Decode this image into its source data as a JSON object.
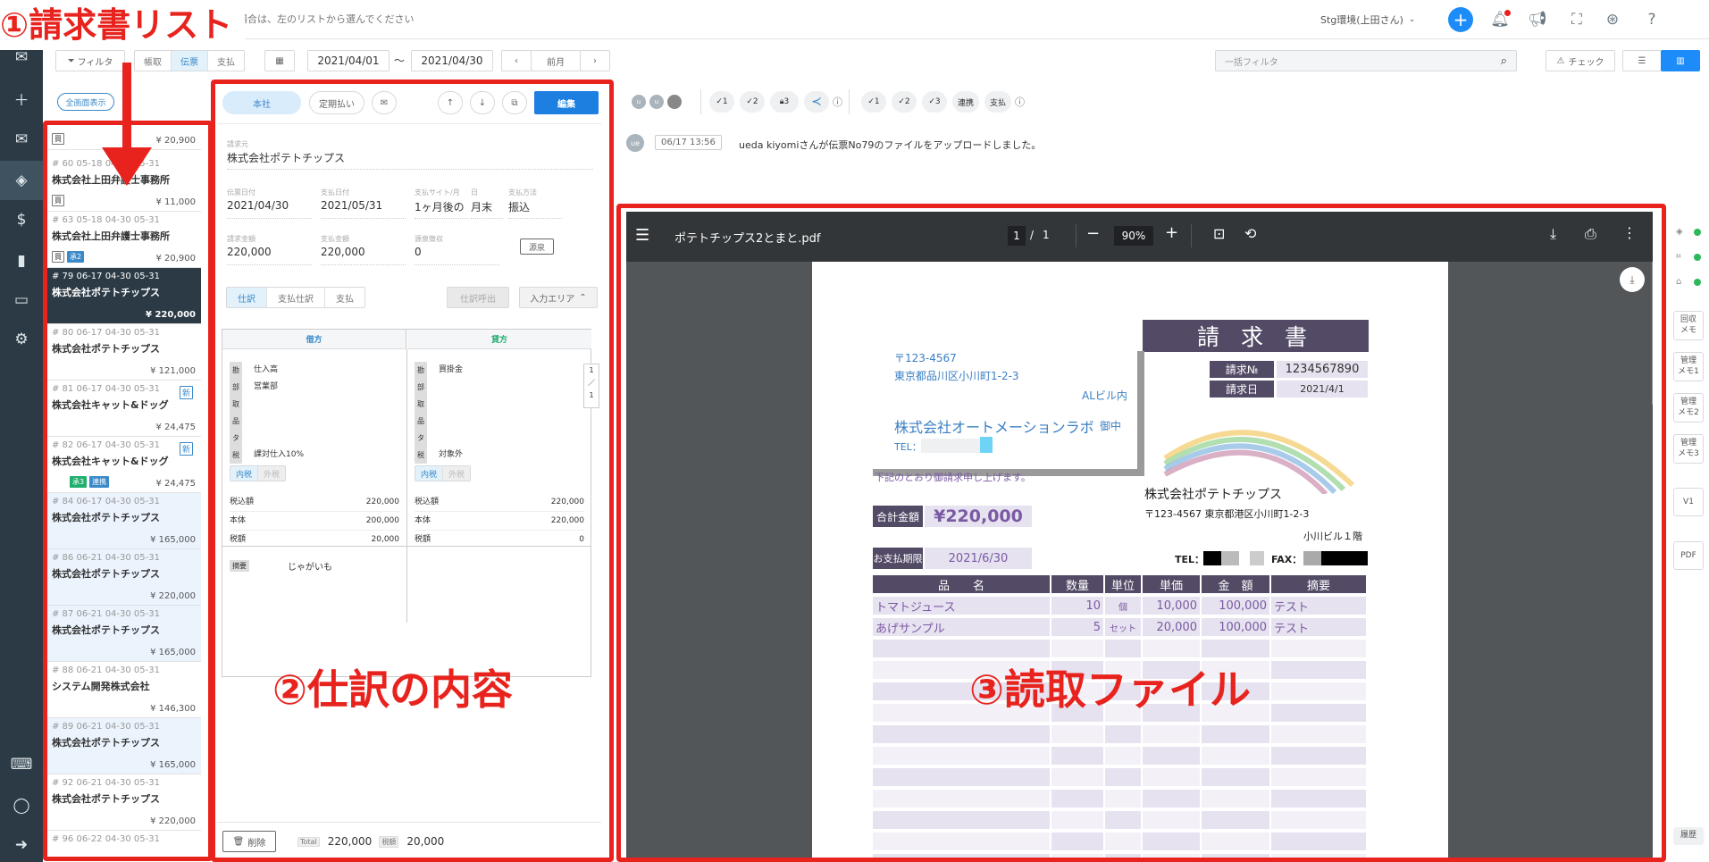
{
  "header": {
    "notice": "請求書を確認する場合は、左のリストから選んでください",
    "user": "Stg環境(上田さん)"
  },
  "toolbar": {
    "filter": "フィルタ",
    "seg_tabs": [
      "帳取",
      "伝票",
      "支払"
    ],
    "date_from": "2021/04/01",
    "tilde": "〜",
    "date_to": "2021/04/30",
    "prev_month": "前月",
    "search_placeholder": "一括フィルタ",
    "check": "チェック"
  },
  "list": {
    "fullscreen_btn": "全画面表示",
    "top_amount": "¥ 20,900",
    "rows": [
      {
        "meta": "# 60  05-18  04-30  05-31",
        "company": "株式会社上田弁護士事務所",
        "amount": "¥ 11,000",
        "tags": [
          "買"
        ]
      },
      {
        "meta": "# 63  05-18  04-30  05-31",
        "company": "株式会社上田弁護士事務所",
        "amount": "¥ 20,900",
        "tags": [
          "買",
          "承2"
        ]
      },
      {
        "meta": "# 79  06-17  04-30  05-31",
        "company": "株式会社ポテトチップス",
        "amount": "¥ 220,000",
        "tags": []
      },
      {
        "meta": "# 80  06-17  04-30  05-31",
        "company": "株式会社ポテトチップス",
        "amount": "¥ 121,000",
        "tags": []
      },
      {
        "meta": "# 81  06-17  04-30  05-31",
        "company": "株式会社キャット&ドッグ",
        "amount": "¥ 24,475",
        "tags": [],
        "new": "新"
      },
      {
        "meta": "# 82  06-17  04-30  05-31",
        "company": "株式会社キャット&ドッグ",
        "amount": "¥ 24,475",
        "tags": [
          "承3",
          "連携"
        ],
        "new": "新"
      },
      {
        "meta": "# 84  06-17  04-30  05-31",
        "company": "株式会社ポテトチップス",
        "amount": "¥ 165,000",
        "tags": []
      },
      {
        "meta": "# 86  06-21  04-30  05-31",
        "company": "株式会社ポテトチップス",
        "amount": "¥ 220,000",
        "tags": []
      },
      {
        "meta": "# 87  06-21  04-30  05-31",
        "company": "株式会社ポテトチップス",
        "amount": "¥ 165,000",
        "tags": []
      },
      {
        "meta": "# 88  06-21  04-30  05-31",
        "company": "システム開発株式会社",
        "amount": "¥ 146,300",
        "tags": []
      },
      {
        "meta": "# 89  06-21  04-30  05-31",
        "company": "株式会社ポテトチップス",
        "amount": "¥ 165,000",
        "tags": []
      },
      {
        "meta": "# 92  06-21  04-30  05-31",
        "company": "株式会社ポテトチップス",
        "amount": "¥ 220,000",
        "tags": []
      },
      {
        "meta": "# 96  06-22  04-30  05-31",
        "company": "",
        "amount": "",
        "tags": []
      }
    ]
  },
  "journal": {
    "btn_honsha": "本社",
    "btn_teiki": "定期払い",
    "btn_edit": "編集",
    "label_seller": "請求元",
    "seller": "株式会社ポテトチップス",
    "label_issue": "伝票日付",
    "issue_date": "2021/04/30",
    "label_pay": "支払日付",
    "pay_date": "2021/05/31",
    "label_site": "支払サイト/月",
    "site": "1ヶ月後の",
    "label_day": "日",
    "day": "月末",
    "label_method": "支払方法",
    "method": "振込",
    "label_billed": "請求金額",
    "billed": "220,000",
    "label_payamt": "支払金額",
    "payamt": "220,000",
    "label_withhold": "源泉徴収",
    "withhold": "0",
    "gensen_btn": "源泉",
    "tabs": [
      "仕訳",
      "支払仕訳",
      "支払"
    ],
    "import_btn": "仕訳呼出",
    "input_area": "入力エリア",
    "debit_title": "借方",
    "credit_title": "貸方",
    "debit_rows": [
      [
        "勘",
        "仕入高"
      ],
      [
        "部",
        "営業部"
      ],
      [
        "取",
        ""
      ],
      [
        "品",
        ""
      ],
      [
        "タ",
        ""
      ],
      [
        "税",
        "課対仕入10%"
      ]
    ],
    "credit_rows": [
      [
        "勘",
        "買掛金"
      ],
      [
        "部",
        ""
      ],
      [
        "取",
        ""
      ],
      [
        "品",
        ""
      ],
      [
        "タ",
        ""
      ],
      [
        "税",
        "対象外"
      ]
    ],
    "tax_in": "内税",
    "tax_out": "外税",
    "sum_labels": [
      "税込額",
      "本体",
      "税額"
    ],
    "debit_sums": [
      "220,000",
      "200,000",
      "20,000"
    ],
    "credit_sums": [
      "220,000",
      "220,000",
      "0"
    ],
    "page_ind": [
      "1",
      "／",
      "1"
    ],
    "memo_label": "摘要",
    "memo": "じゃがいも",
    "delete_btn": "削除",
    "total_label": "Total",
    "total": "220,000",
    "tax_label": "税額",
    "tax_total": "20,000"
  },
  "activity": {
    "avatar": "ue",
    "timestamp": "06/17 13:56",
    "message": "ueda kiyomiさんが伝票No79のファイルをアップロードしました。",
    "approve_group1": [
      "1",
      "2",
      "3"
    ],
    "approve_group2": [
      "1",
      "2",
      "3"
    ],
    "link_label": "連携",
    "pay_label": "支払"
  },
  "pdf": {
    "filename": "ポテトチップス2とまと.pdf",
    "page_current": "1",
    "page_sep": "/",
    "page_total": "1",
    "zoom": "90%",
    "doc_title": "請 求 書",
    "postal": "〒123-4567",
    "addr": "東京都品川区小川町1-2-3",
    "bldg": "ALビル内",
    "recipient": "株式会社オートメーションラボ",
    "onchu": "御中",
    "tel": "TEL：(",
    "invoice_no_label": "請求№",
    "invoice_no": "1234567890",
    "invoice_date_label": "請求日",
    "invoice_date": "2021/4/1",
    "greeting": "下記のとおり御請求申し上げます。",
    "total_label": "合計金額",
    "total": "¥220,000",
    "due_label": "お支払期限",
    "due": "2021/6/30",
    "issuer": "株式会社ポテトチップス",
    "issuer_addr": "〒123-4567  東京都港区小川町1-2-3",
    "issuer_bldg": "小川ビル１階",
    "issuer_tel": "TEL：",
    "issuer_fax": "FAX：",
    "headers": [
      "品　　名",
      "数量",
      "単位",
      "単価",
      "金　額",
      "摘要"
    ],
    "items": [
      [
        "トマトジュース",
        "10",
        "個",
        "10,000",
        "100,000",
        "テスト"
      ],
      [
        "あげサンプル",
        "5",
        "セット",
        "20,000",
        "100,000",
        "テスト"
      ]
    ]
  },
  "rail": [
    "回収\nメモ",
    "管理\nメモ1",
    "管理\nメモ2",
    "管理\nメモ3",
    "V1",
    "PDF",
    "履歴"
  ],
  "annotations": {
    "a1": "①請求書リスト",
    "a2": "②仕訳の内容",
    "a3": "③読取ファイル"
  }
}
